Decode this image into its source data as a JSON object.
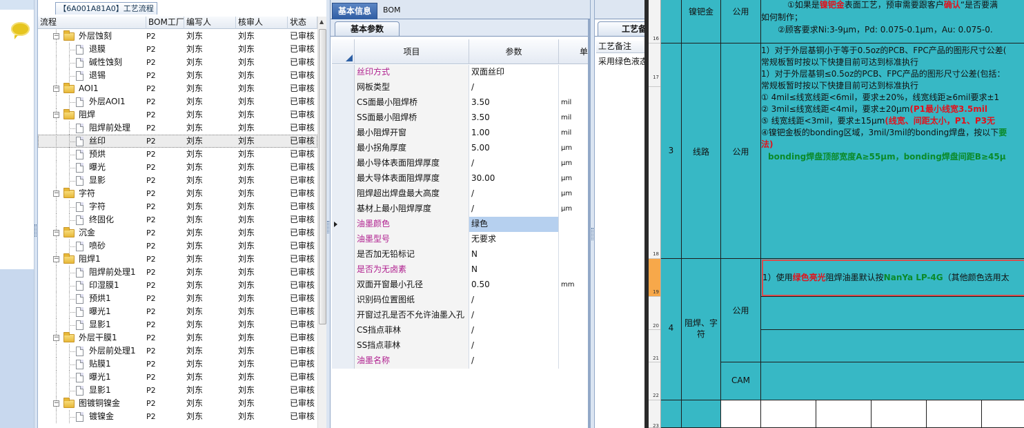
{
  "flow_tab": {
    "title": "【6A001A81A0】工艺流程"
  },
  "tree": {
    "columns": [
      "流程",
      "BOM工厂",
      "编写人",
      "核审人",
      "状态"
    ],
    "rows": [
      {
        "type": "folder",
        "name": "外层蚀刻",
        "bom": "P2",
        "editor": "刘东",
        "reviewer": "刘东",
        "status": "已审核"
      },
      {
        "type": "doc",
        "name": "退膜",
        "bom": "P2",
        "editor": "刘东",
        "reviewer": "刘东",
        "status": "已审核"
      },
      {
        "type": "doc",
        "name": "碱性蚀刻",
        "bom": "P2",
        "editor": "刘东",
        "reviewer": "刘东",
        "status": "已审核"
      },
      {
        "type": "doc",
        "name": "退锡",
        "bom": "P2",
        "editor": "刘东",
        "reviewer": "刘东",
        "status": "已审核"
      },
      {
        "type": "folder",
        "name": "AOI1",
        "bom": "P2",
        "editor": "刘东",
        "reviewer": "刘东",
        "status": "已审核"
      },
      {
        "type": "doc",
        "name": "外层AOI1",
        "bom": "P2",
        "editor": "刘东",
        "reviewer": "刘东",
        "status": "已审核"
      },
      {
        "type": "folder",
        "name": "阻焊",
        "bom": "P2",
        "editor": "刘东",
        "reviewer": "刘东",
        "status": "已审核"
      },
      {
        "type": "doc",
        "name": "阻焊前处理",
        "bom": "P2",
        "editor": "刘东",
        "reviewer": "刘东",
        "status": "已审核"
      },
      {
        "type": "doc",
        "name": "丝印",
        "bom": "P2",
        "editor": "刘东",
        "reviewer": "刘东",
        "status": "已审核",
        "selected": true
      },
      {
        "type": "doc",
        "name": "预烘",
        "bom": "P2",
        "editor": "刘东",
        "reviewer": "刘东",
        "status": "已审核"
      },
      {
        "type": "doc",
        "name": "曝光",
        "bom": "P2",
        "editor": "刘东",
        "reviewer": "刘东",
        "status": "已审核"
      },
      {
        "type": "doc",
        "name": "显影",
        "bom": "P2",
        "editor": "刘东",
        "reviewer": "刘东",
        "status": "已审核"
      },
      {
        "type": "folder",
        "name": "字符",
        "bom": "P2",
        "editor": "刘东",
        "reviewer": "刘东",
        "status": "已审核"
      },
      {
        "type": "doc",
        "name": "字符",
        "bom": "P2",
        "editor": "刘东",
        "reviewer": "刘东",
        "status": "已审核"
      },
      {
        "type": "doc",
        "name": "终固化",
        "bom": "P2",
        "editor": "刘东",
        "reviewer": "刘东",
        "status": "已审核"
      },
      {
        "type": "folder",
        "name": "沉金",
        "bom": "P2",
        "editor": "刘东",
        "reviewer": "刘东",
        "status": "已审核"
      },
      {
        "type": "doc",
        "name": "喷砂",
        "bom": "P2",
        "editor": "刘东",
        "reviewer": "刘东",
        "status": "已审核"
      },
      {
        "type": "folder",
        "name": "阻焊1",
        "bom": "P2",
        "editor": "刘东",
        "reviewer": "刘东",
        "status": "已审核"
      },
      {
        "type": "doc",
        "name": "阻焊前处理1",
        "bom": "P2",
        "editor": "刘东",
        "reviewer": "刘东",
        "status": "已审核"
      },
      {
        "type": "doc",
        "name": "印湿膜1",
        "bom": "P2",
        "editor": "刘东",
        "reviewer": "刘东",
        "status": "已审核"
      },
      {
        "type": "doc",
        "name": "预烘1",
        "bom": "P2",
        "editor": "刘东",
        "reviewer": "刘东",
        "status": "已审核"
      },
      {
        "type": "doc",
        "name": "曝光1",
        "bom": "P2",
        "editor": "刘东",
        "reviewer": "刘东",
        "status": "已审核"
      },
      {
        "type": "doc",
        "name": "显影1",
        "bom": "P2",
        "editor": "刘东",
        "reviewer": "刘东",
        "status": "已审核"
      },
      {
        "type": "folder",
        "name": "外层干膜1",
        "bom": "P2",
        "editor": "刘东",
        "reviewer": "刘东",
        "status": "已审核"
      },
      {
        "type": "doc",
        "name": "外层前处理1",
        "bom": "P2",
        "editor": "刘东",
        "reviewer": "刘东",
        "status": "已审核"
      },
      {
        "type": "doc",
        "name": "贴膜1",
        "bom": "P2",
        "editor": "刘东",
        "reviewer": "刘东",
        "status": "已审核"
      },
      {
        "type": "doc",
        "name": "曝光1",
        "bom": "P2",
        "editor": "刘东",
        "reviewer": "刘东",
        "status": "已审核"
      },
      {
        "type": "doc",
        "name": "显影1",
        "bom": "P2",
        "editor": "刘东",
        "reviewer": "刘东",
        "status": "已审核"
      },
      {
        "type": "folder",
        "name": "图镀铜镍金",
        "bom": "P2",
        "editor": "刘东",
        "reviewer": "刘东",
        "status": "已审核"
      },
      {
        "type": "doc",
        "name": "镀镍金",
        "bom": "P2",
        "editor": "刘东",
        "reviewer": "刘东",
        "status": "已审核"
      }
    ]
  },
  "mid_tabs": [
    "基本信息",
    "BOM"
  ],
  "param_tab": "基本参数",
  "grid": {
    "headers": [
      "项目",
      "参数",
      "单"
    ],
    "rows": [
      {
        "item": "丝印方式",
        "value": "双面丝印",
        "unit": "",
        "magenta": true
      },
      {
        "item": "网板类型",
        "value": "/",
        "unit": ""
      },
      {
        "item": "CS面最小阻焊桥",
        "value": "3.50",
        "unit": "mil"
      },
      {
        "item": "SS面最小阻焊桥",
        "value": "3.50",
        "unit": "mil"
      },
      {
        "item": "最小阻焊开窗",
        "value": "1.00",
        "unit": "mil"
      },
      {
        "item": "最小拐角厚度",
        "value": "5.00",
        "unit": "μm"
      },
      {
        "item": "最小导体表面阻焊厚度",
        "value": "/",
        "unit": "μm"
      },
      {
        "item": "最大导体表面阻焊厚度",
        "value": "30.00",
        "unit": "μm"
      },
      {
        "item": "阻焊超出焊盘最大高度",
        "value": "/",
        "unit": "μm"
      },
      {
        "item": "基材上最小阻焊厚度",
        "value": "/",
        "unit": "μm"
      },
      {
        "item": "油墨颜色",
        "value": "绿色",
        "unit": "",
        "magenta": true,
        "selected": true
      },
      {
        "item": "油墨型号",
        "value": "无要求",
        "unit": "",
        "magenta": true
      },
      {
        "item": "是否加无铅标记",
        "value": "N",
        "unit": ""
      },
      {
        "item": "是否为无卤素",
        "value": "N",
        "unit": "",
        "magenta": true
      },
      {
        "item": "双面开窗最小孔径",
        "value": "0.50",
        "unit": "mm"
      },
      {
        "item": "识别码位置图纸",
        "value": "/",
        "unit": ""
      },
      {
        "item": "开窗过孔是否不允许油墨入孔",
        "value": "/",
        "unit": ""
      },
      {
        "item": "CS挡点菲林",
        "value": "/",
        "unit": ""
      },
      {
        "item": "SS挡点菲林",
        "value": "/",
        "unit": ""
      },
      {
        "item": "油墨名称",
        "value": "/",
        "unit": "",
        "magenta": true
      }
    ]
  },
  "process": {
    "tab": "工艺备",
    "header": "工艺备注",
    "value": "采用绿色液态"
  },
  "sheet": {
    "row_numbers": [
      "16",
      "17",
      "18",
      "19",
      "20",
      "21",
      "22",
      "23"
    ],
    "r1": {
      "type": "镍钯金",
      "scope": "公用"
    },
    "r1_lines": [
      "①如果是",
      "镍钯金",
      "表面工艺，预审需要跟客户",
      "确认",
      "“是否要满",
      "如何制作；",
      "②顾客要求Ni:3-9μm，Pd: 0.075-0.1μm，Au: 0.075-0."
    ],
    "r2": {
      "no": "3",
      "type": "线路",
      "scope": "公用"
    },
    "r2_lines": [
      "1）对于外层基铜小于等于0.5oz的PCB、FPC产品的图形尺寸公差(",
      "常规板暂时按以下快捷目前可达到标准执行",
      "1）对于外层基铜≤0.5oz的PCB、FPC产品的图形尺寸公差(包括：",
      "常规板暂时按以下快捷目前可达到标准执行",
      "① 4mil≤线宽线距<6mil，要求±20%，线宽线距≥6mil要求±1",
      "② 3mil≤线宽线距<4mil，要求±20μm",
      "(P1最小线宽3.5mil",
      "⑤ 线宽线距<3mil，要求±15μm",
      "(线宽、间距太小，P1、P3无",
      "④镍钯金板的bonding区域，3mil/3mil的bonding焊盘，按以下",
      "要",
      "法)",
      "bonding焊盘顶部宽度A≥55μm，bonding焊盘间距B≥45μ"
    ],
    "r3": {
      "no": "4",
      "type": "阻焊、字符",
      "scope": "公用",
      "cam": "CAM"
    },
    "r3_line_parts": [
      "1）使用",
      "绿色亮光",
      "阻焊油墨默认按",
      "NanYa LP-4G",
      "（其他颜色选用太"
    ]
  }
}
